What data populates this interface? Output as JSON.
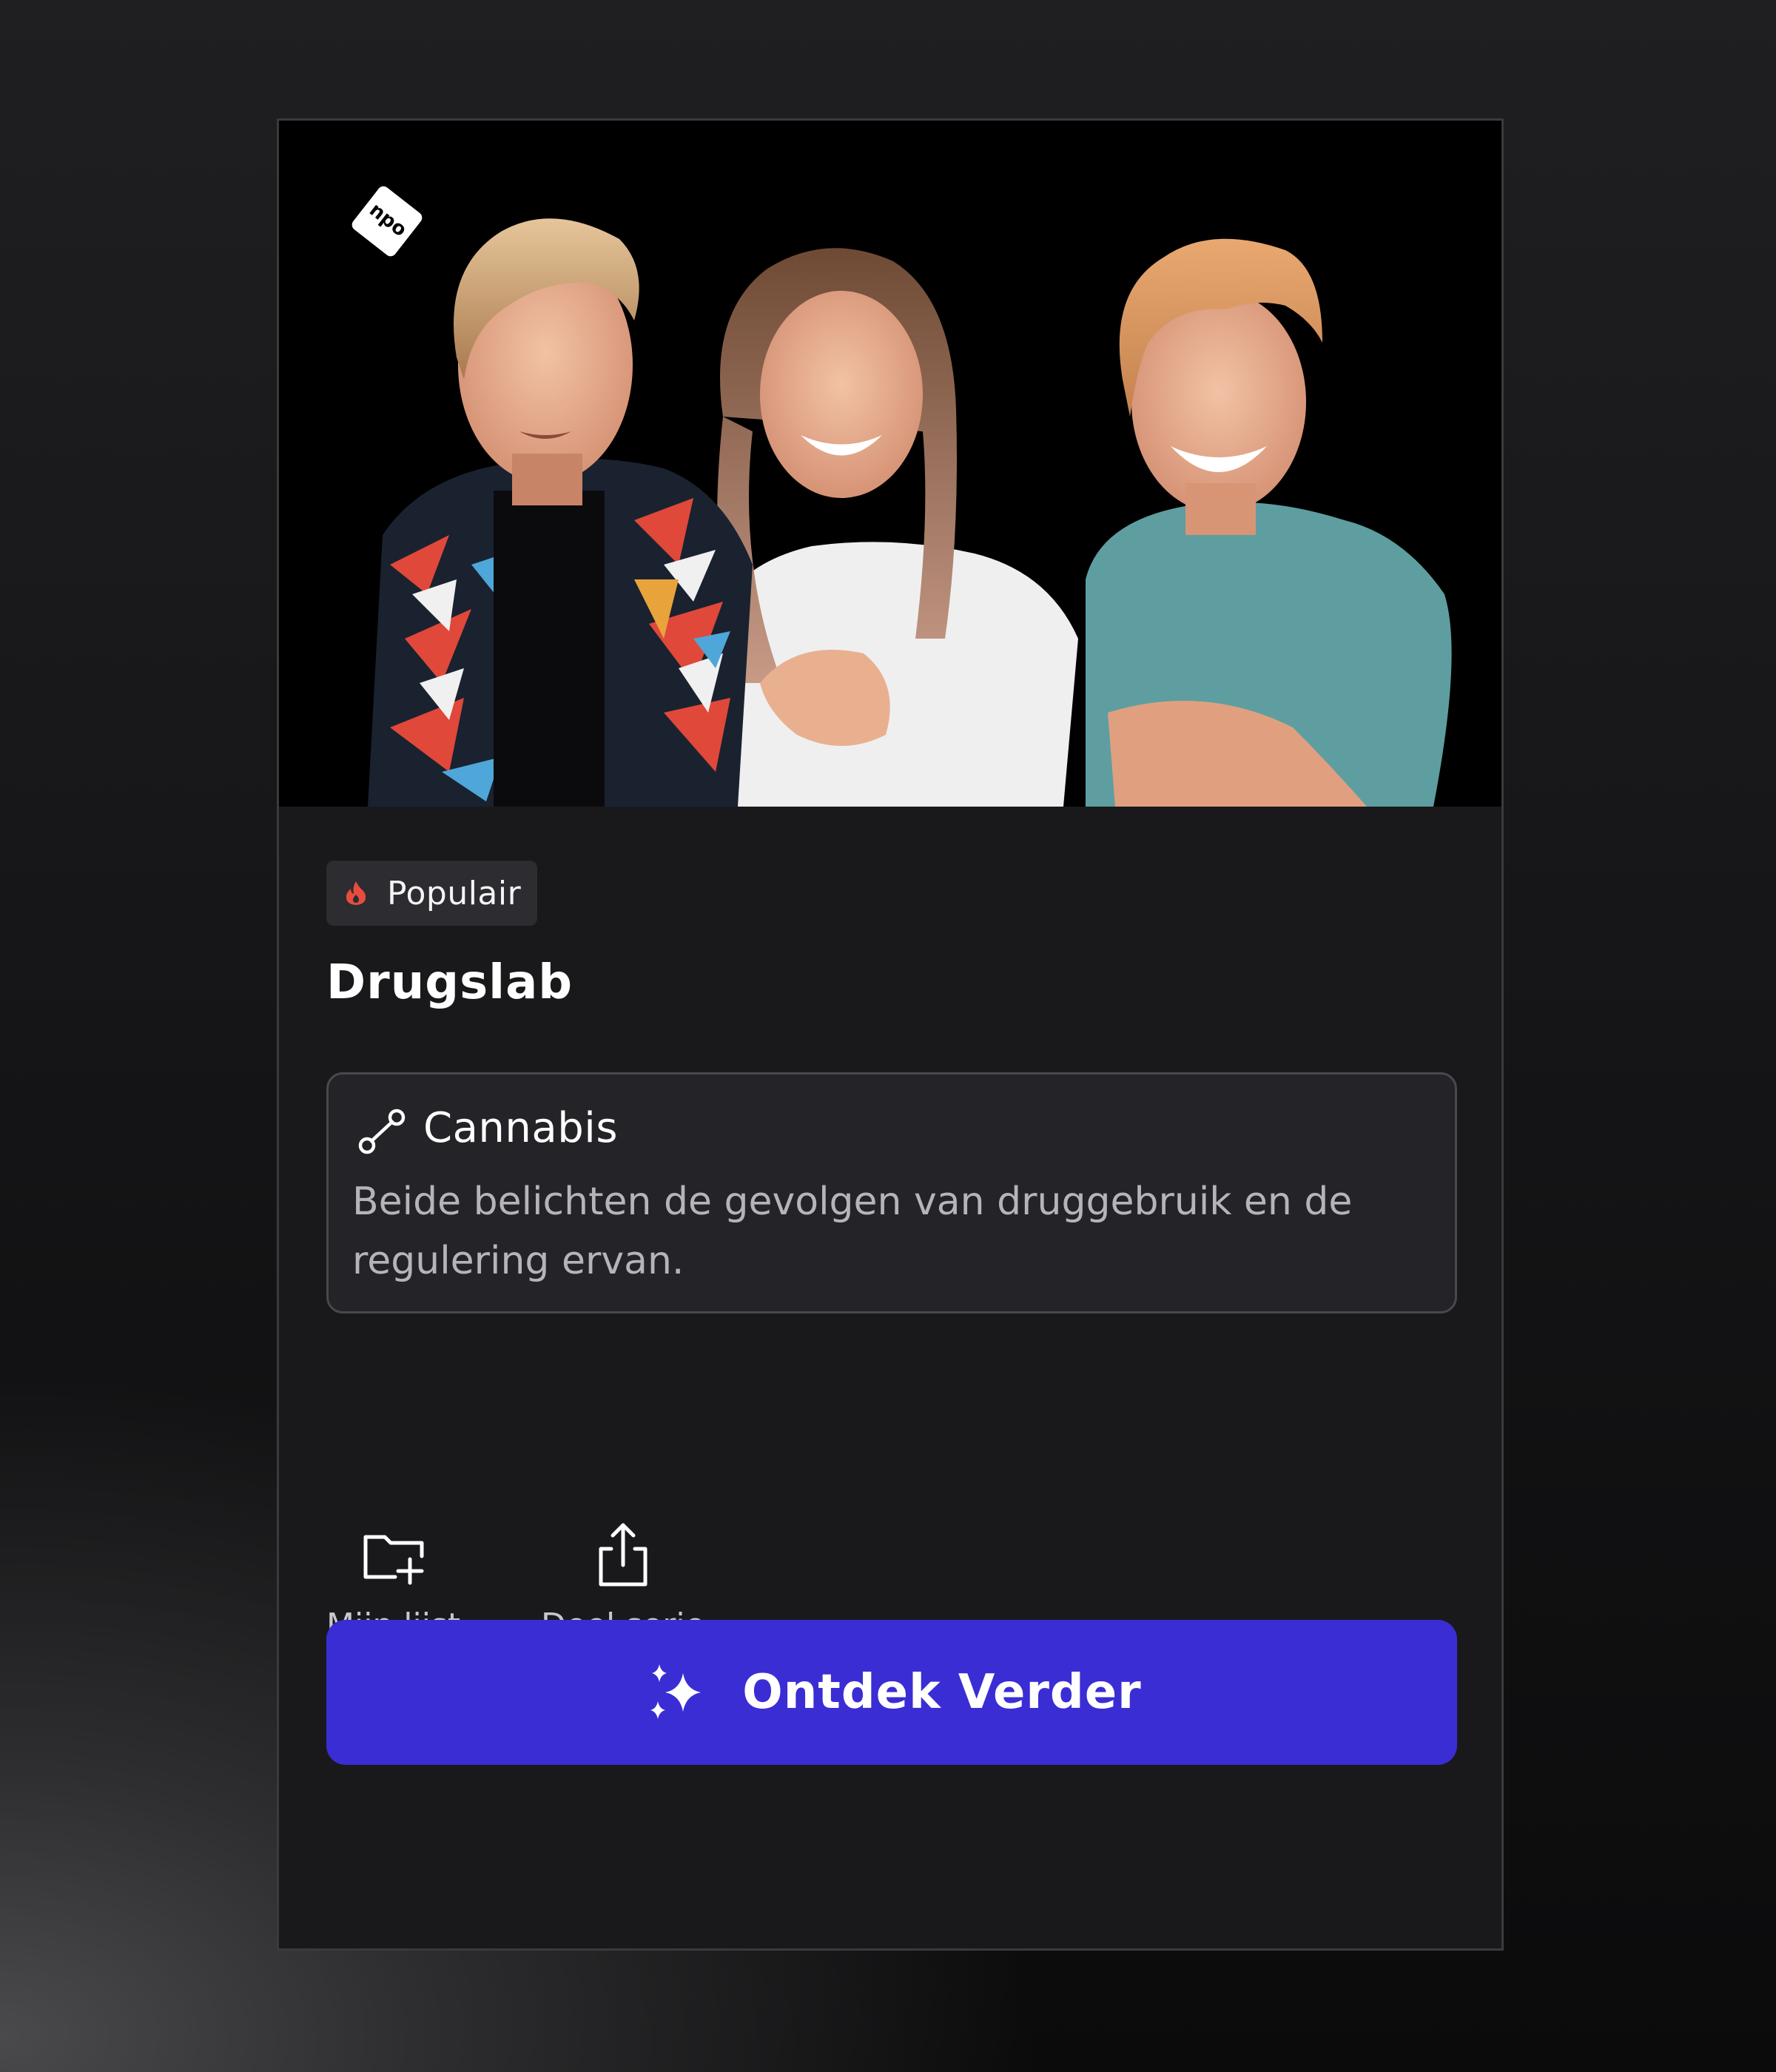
{
  "hero": {
    "image": "Three smiling presenters posing close to the camera against a black background",
    "channel_logo": "npo"
  },
  "badge": {
    "icon": "flame-icon",
    "icon_color": "#e84c3d",
    "label": "Populair"
  },
  "show": {
    "title": "Drugslab"
  },
  "episode_info": {
    "icon": "route-icon",
    "title": "Cannabis",
    "description": "Beide belichten de gevolgen van druggebruik en de regulering ervan."
  },
  "actions": [
    {
      "icon": "folder-add-icon",
      "label": "Mijn lijst"
    },
    {
      "icon": "share-icon",
      "label": "Deel serie"
    }
  ],
  "cta": {
    "icon": "sparkles-icon",
    "label": "Ontdek Verder",
    "color": "#3b2dd4"
  },
  "colors": {
    "card_background": "#19191c",
    "text_primary": "#ffffff",
    "text_secondary": "#b4b4ba"
  }
}
